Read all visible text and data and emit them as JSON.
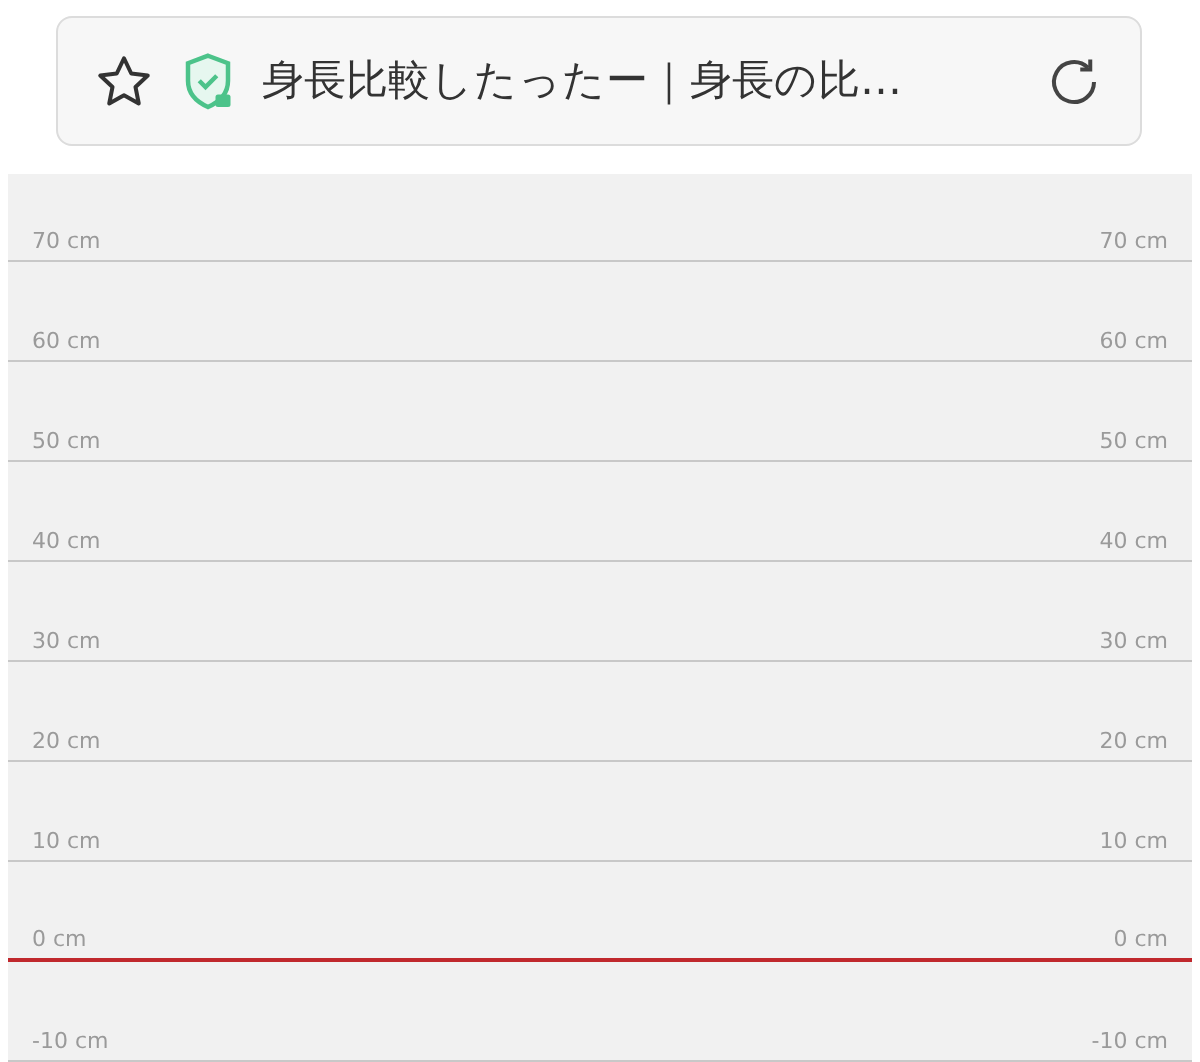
{
  "address_bar": {
    "title": "身長比較したったー｜身長の比…"
  },
  "scale": [
    {
      "left_label": "70 cm",
      "right_label": "70 cm",
      "kind": "grid"
    },
    {
      "left_label": "60 cm",
      "right_label": "60 cm",
      "kind": "grid"
    },
    {
      "left_label": "50 cm",
      "right_label": "50 cm",
      "kind": "grid"
    },
    {
      "left_label": "40 cm",
      "right_label": "40 cm",
      "kind": "grid"
    },
    {
      "left_label": "30 cm",
      "right_label": "30 cm",
      "kind": "grid"
    },
    {
      "left_label": "20 cm",
      "right_label": "20 cm",
      "kind": "grid"
    },
    {
      "left_label": "10 cm",
      "right_label": "10 cm",
      "kind": "grid"
    },
    {
      "left_label": "0 cm",
      "right_label": "0 cm",
      "kind": "baseline"
    },
    {
      "left_label": "-10 cm",
      "right_label": "-10 cm",
      "kind": "grid"
    }
  ]
}
